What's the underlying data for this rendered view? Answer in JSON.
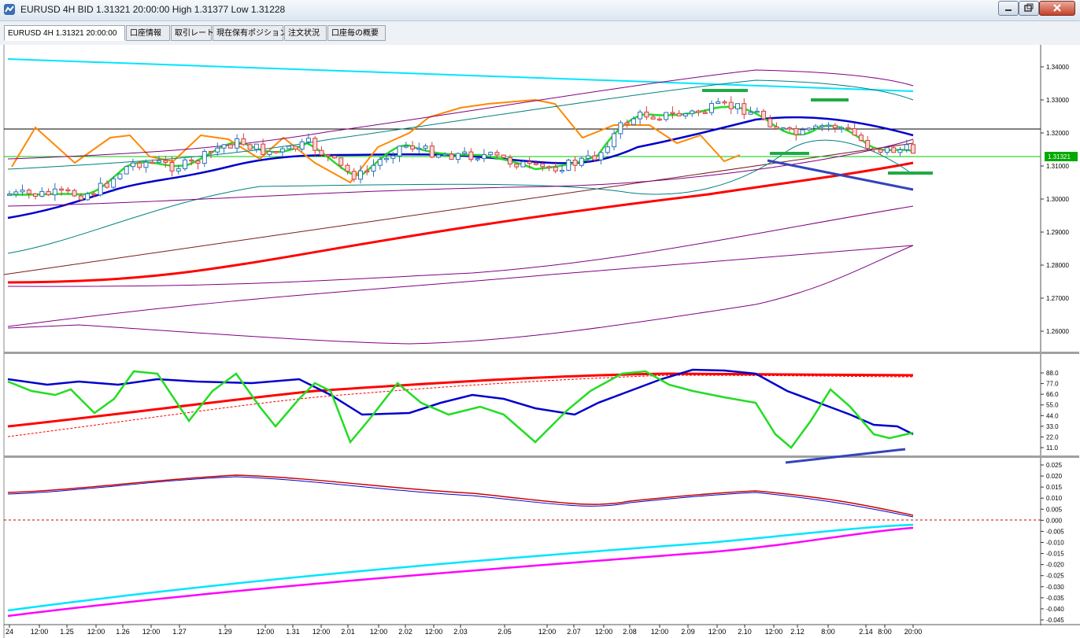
{
  "window": {
    "title": "EURUSD 4H BID 1.31321 20:00:00 High 1.31377 Low 1.31228"
  },
  "tabs": [
    {
      "label": "EURUSD 4H 1.31321 20:00:00",
      "active": true
    },
    {
      "label": "口座情報"
    },
    {
      "label": "取引レート"
    },
    {
      "label": "現在保有ポジション"
    },
    {
      "label": "注文状況"
    },
    {
      "label": "口座毎の概要"
    }
  ],
  "colors": {
    "price_marker": "#00aa00",
    "trendline_cyan": "#00e5ff",
    "ma_long": "#ff0000",
    "ma_mid": "#0000cc",
    "ma_short": "#22dd22",
    "orange_line": "#ff8800",
    "bollinger_outer": "#800080",
    "bollinger_inner": "#008080",
    "divergence_line": "#3344bb"
  },
  "chart_data": [
    {
      "type": "candlestick",
      "symbol": "EURUSD",
      "timeframe": "4H",
      "current_price": "1.31321",
      "yticks": [
        "1.34000",
        "1.33000",
        "1.32000",
        "1.31000",
        "1.30000",
        "1.29000",
        "1.28000",
        "1.27000",
        "1.26000"
      ],
      "xticks": [
        "24",
        "12:00",
        "1.25",
        "12:00",
        "1.26",
        "12:00",
        "1.27",
        "1.29",
        "12:00",
        "1.31",
        "12:00",
        "2.01",
        "12:00",
        "2.02",
        "12:00",
        "2.03",
        "2.05",
        "12:00",
        "2.07",
        "12:00",
        "2.08",
        "12:00",
        "2.09",
        "12:00",
        "2.10",
        "12:00",
        "2.12",
        "8:00",
        "2.14",
        "8:00",
        "20:00"
      ],
      "ylim": [
        1.2555,
        1.3465
      ]
    },
    {
      "type": "line",
      "yticks": [
        "88.0",
        "77.0",
        "66.0",
        "55.0",
        "44.0",
        "33.0",
        "22.0",
        "11.0"
      ],
      "ylim": [
        5,
        94
      ]
    },
    {
      "type": "line",
      "yticks": [
        "0.025",
        "0.020",
        "0.015",
        "0.010",
        "0.005",
        "0.000",
        "-0.005",
        "-0.010",
        "-0.015",
        "-0.020",
        "-0.025",
        "-0.030",
        "-0.035",
        "-0.040",
        "-0.045"
      ],
      "ylim": [
        -0.046,
        0.027
      ]
    }
  ]
}
